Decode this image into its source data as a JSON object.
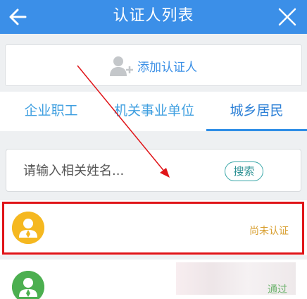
{
  "header": {
    "title": "认证人列表",
    "back_icon": "arrow-left-icon",
    "close_icon": "close-icon",
    "color": "#3b8fe8"
  },
  "add_button": {
    "label": "添加认证人",
    "icon": "add-person-icon"
  },
  "tabs": [
    {
      "label": "企业职工",
      "selected": false
    },
    {
      "label": "机关事业单位",
      "selected": false
    },
    {
      "label": "城乡居民",
      "selected": true
    }
  ],
  "search": {
    "placeholder": "请输入相关姓名...",
    "button_label": "搜索"
  },
  "list": [
    {
      "avatar_color": "#f5b820",
      "status": "尚未认证"
    },
    {
      "avatar_color": "#4caf50",
      "status": "通过"
    }
  ],
  "annotation": {
    "highlight_color": "#e01418"
  }
}
